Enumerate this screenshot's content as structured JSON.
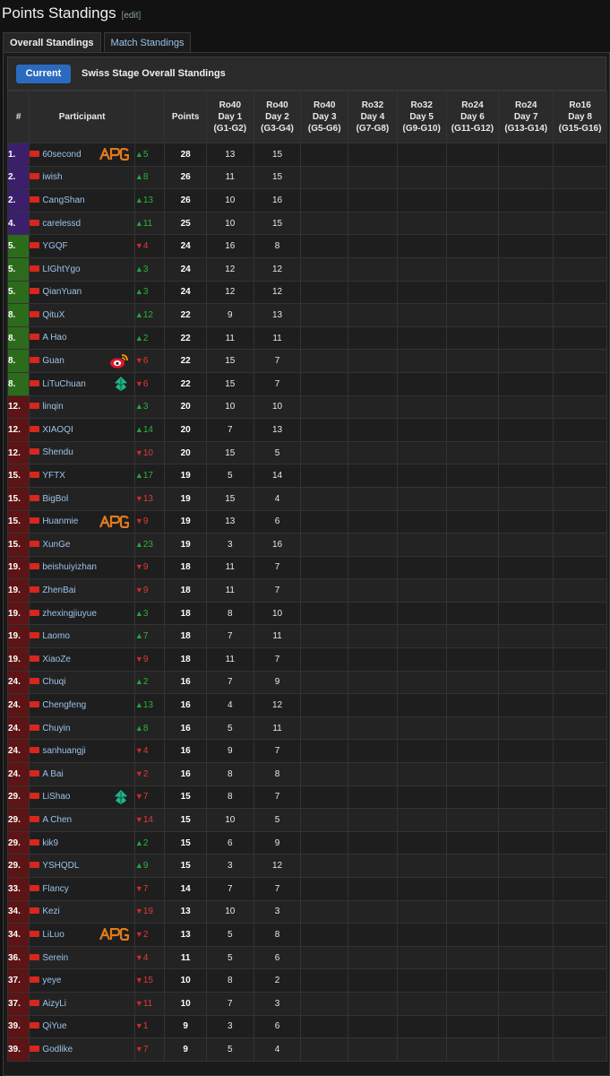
{
  "page": {
    "title": "Points Standings",
    "edit_label": "edit"
  },
  "tabs": [
    {
      "label": "Overall Standings",
      "active": true
    },
    {
      "label": "Match Standings",
      "active": false
    }
  ],
  "toolbar": {
    "current_label": "Current",
    "title": "Swiss Stage Overall Standings"
  },
  "table": {
    "headers": {
      "rank": "#",
      "participant": "Participant",
      "points": "Points",
      "days": [
        [
          "Ro40",
          "Day 1",
          "(G1-G2)"
        ],
        [
          "Ro40",
          "Day 2",
          "(G3-G4)"
        ],
        [
          "Ro40",
          "Day 3",
          "(G5-G6)"
        ],
        [
          "Ro32",
          "Day 4",
          "(G7-G8)"
        ],
        [
          "Ro32",
          "Day 5",
          "(G9-G10)"
        ],
        [
          "Ro24",
          "Day 6",
          "(G11-G12)"
        ],
        [
          "Ro24",
          "Day 7",
          "(G13-G14)"
        ],
        [
          "Ro16",
          "Day 8",
          "(G15-G16)"
        ]
      ]
    },
    "rows": [
      {
        "rank": "1.",
        "name": "60second",
        "team": "apg",
        "dir": "up",
        "chg": "5",
        "pts": "28",
        "d1": "13",
        "d2": "15"
      },
      {
        "rank": "2.",
        "name": "iwish",
        "team": "",
        "dir": "up",
        "chg": "8",
        "pts": "26",
        "d1": "11",
        "d2": "15"
      },
      {
        "rank": "2.",
        "name": "CangShan",
        "team": "",
        "dir": "up",
        "chg": "13",
        "pts": "26",
        "d1": "10",
        "d2": "16"
      },
      {
        "rank": "4.",
        "name": "carelessd",
        "team": "",
        "dir": "up",
        "chg": "11",
        "pts": "25",
        "d1": "10",
        "d2": "15"
      },
      {
        "rank": "5.",
        "name": "YGQF",
        "team": "",
        "dir": "down",
        "chg": "4",
        "pts": "24",
        "d1": "16",
        "d2": "8"
      },
      {
        "rank": "5.",
        "name": "LIGhtYgo",
        "team": "",
        "dir": "up",
        "chg": "3",
        "pts": "24",
        "d1": "12",
        "d2": "12"
      },
      {
        "rank": "5.",
        "name": "QianYuan",
        "team": "",
        "dir": "up",
        "chg": "3",
        "pts": "24",
        "d1": "12",
        "d2": "12"
      },
      {
        "rank": "8.",
        "name": "QituX",
        "team": "",
        "dir": "up",
        "chg": "12",
        "pts": "22",
        "d1": "9",
        "d2": "13"
      },
      {
        "rank": "8.",
        "name": "A Hao",
        "team": "",
        "dir": "up",
        "chg": "2",
        "pts": "22",
        "d1": "11",
        "d2": "11"
      },
      {
        "rank": "8.",
        "name": "Guan",
        "team": "weibo",
        "dir": "down",
        "chg": "6",
        "pts": "22",
        "d1": "15",
        "d2": "7"
      },
      {
        "rank": "8.",
        "name": "LiTuChuan",
        "team": "leaf",
        "dir": "down",
        "chg": "6",
        "pts": "22",
        "d1": "15",
        "d2": "7"
      },
      {
        "rank": "12.",
        "name": "linqin",
        "team": "",
        "dir": "up",
        "chg": "3",
        "pts": "20",
        "d1": "10",
        "d2": "10"
      },
      {
        "rank": "12.",
        "name": "XIAOQI",
        "team": "",
        "dir": "up",
        "chg": "14",
        "pts": "20",
        "d1": "7",
        "d2": "13"
      },
      {
        "rank": "12.",
        "name": "Shendu",
        "team": "",
        "dir": "down",
        "chg": "10",
        "pts": "20",
        "d1": "15",
        "d2": "5"
      },
      {
        "rank": "15.",
        "name": "YFTX",
        "team": "",
        "dir": "up",
        "chg": "17",
        "pts": "19",
        "d1": "5",
        "d2": "14"
      },
      {
        "rank": "15.",
        "name": "BigBol",
        "team": "",
        "dir": "down",
        "chg": "13",
        "pts": "19",
        "d1": "15",
        "d2": "4"
      },
      {
        "rank": "15.",
        "name": "Huanmie",
        "team": "apg",
        "dir": "down",
        "chg": "9",
        "pts": "19",
        "d1": "13",
        "d2": "6"
      },
      {
        "rank": "15.",
        "name": "XunGe",
        "team": "",
        "dir": "up",
        "chg": "23",
        "pts": "19",
        "d1": "3",
        "d2": "16"
      },
      {
        "rank": "19.",
        "name": "beishuiyizhan",
        "team": "",
        "dir": "down",
        "chg": "9",
        "pts": "18",
        "d1": "11",
        "d2": "7"
      },
      {
        "rank": "19.",
        "name": "ZhenBai",
        "team": "",
        "dir": "down",
        "chg": "9",
        "pts": "18",
        "d1": "11",
        "d2": "7"
      },
      {
        "rank": "19.",
        "name": "zhexingjiuyue",
        "team": "",
        "dir": "up",
        "chg": "3",
        "pts": "18",
        "d1": "8",
        "d2": "10"
      },
      {
        "rank": "19.",
        "name": "Laomo",
        "team": "",
        "dir": "up",
        "chg": "7",
        "pts": "18",
        "d1": "7",
        "d2": "11"
      },
      {
        "rank": "19.",
        "name": "XiaoZe",
        "team": "",
        "dir": "down",
        "chg": "9",
        "pts": "18",
        "d1": "11",
        "d2": "7"
      },
      {
        "rank": "24.",
        "name": "Chuqi",
        "team": "",
        "dir": "up",
        "chg": "2",
        "pts": "16",
        "d1": "7",
        "d2": "9"
      },
      {
        "rank": "24.",
        "name": "Chengfeng",
        "team": "",
        "dir": "up",
        "chg": "13",
        "pts": "16",
        "d1": "4",
        "d2": "12"
      },
      {
        "rank": "24.",
        "name": "Chuyin",
        "team": "",
        "dir": "up",
        "chg": "8",
        "pts": "16",
        "d1": "5",
        "d2": "11"
      },
      {
        "rank": "24.",
        "name": "sanhuangji",
        "team": "",
        "dir": "down",
        "chg": "4",
        "pts": "16",
        "d1": "9",
        "d2": "7"
      },
      {
        "rank": "24.",
        "name": "A Bai",
        "team": "",
        "dir": "down",
        "chg": "2",
        "pts": "16",
        "d1": "8",
        "d2": "8"
      },
      {
        "rank": "29.",
        "name": "LiShao",
        "team": "leaf",
        "dir": "down",
        "chg": "7",
        "pts": "15",
        "d1": "8",
        "d2": "7"
      },
      {
        "rank": "29.",
        "name": "A Chen",
        "team": "",
        "dir": "down",
        "chg": "14",
        "pts": "15",
        "d1": "10",
        "d2": "5"
      },
      {
        "rank": "29.",
        "name": "kik9",
        "team": "",
        "dir": "up",
        "chg": "2",
        "pts": "15",
        "d1": "6",
        "d2": "9"
      },
      {
        "rank": "29.",
        "name": "YSHQDL",
        "team": "",
        "dir": "up",
        "chg": "9",
        "pts": "15",
        "d1": "3",
        "d2": "12"
      },
      {
        "rank": "33.",
        "name": "Flancy",
        "team": "",
        "dir": "down",
        "chg": "7",
        "pts": "14",
        "d1": "7",
        "d2": "7"
      },
      {
        "rank": "34.",
        "name": "Kezi",
        "team": "",
        "dir": "down",
        "chg": "19",
        "pts": "13",
        "d1": "10",
        "d2": "3"
      },
      {
        "rank": "34.",
        "name": "LiLuo",
        "team": "apg",
        "dir": "down",
        "chg": "2",
        "pts": "13",
        "d1": "5",
        "d2": "8"
      },
      {
        "rank": "36.",
        "name": "Serein",
        "team": "",
        "dir": "down",
        "chg": "4",
        "pts": "11",
        "d1": "5",
        "d2": "6"
      },
      {
        "rank": "37.",
        "name": "yeye",
        "team": "",
        "dir": "down",
        "chg": "15",
        "pts": "10",
        "d1": "8",
        "d2": "2"
      },
      {
        "rank": "37.",
        "name": "AizyLi",
        "team": "",
        "dir": "down",
        "chg": "11",
        "pts": "10",
        "d1": "7",
        "d2": "3"
      },
      {
        "rank": "39.",
        "name": "QiYue",
        "team": "",
        "dir": "down",
        "chg": "1",
        "pts": "9",
        "d1": "3",
        "d2": "6"
      },
      {
        "rank": "39.",
        "name": "Godlike",
        "team": "",
        "dir": "down",
        "chg": "7",
        "pts": "9",
        "d1": "5",
        "d2": "4"
      }
    ]
  },
  "colors": {
    "tier": {
      "top4": "#3b1f6b",
      "top11": "#2d6b1c",
      "mid": "#5a2a0e",
      "low": "#5c1414"
    },
    "up": "#2fb045",
    "down": "#e03a3a",
    "link": "#9cc3ea",
    "accent": "#2a6bc0"
  }
}
